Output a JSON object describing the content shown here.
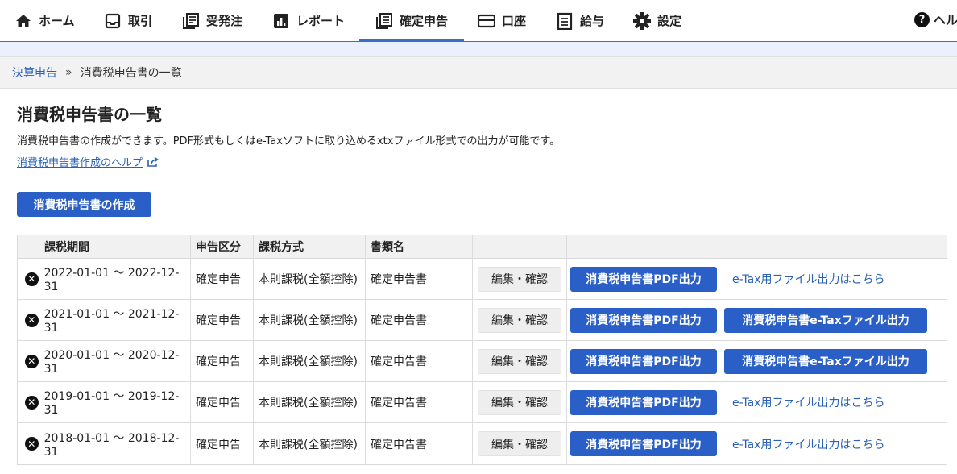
{
  "nav": {
    "items": [
      {
        "label": "ホーム",
        "icon": "home-icon"
      },
      {
        "label": "取引",
        "icon": "inbox-icon"
      },
      {
        "label": "受発注",
        "icon": "documents-icon"
      },
      {
        "label": "レポート",
        "icon": "chart-icon"
      },
      {
        "label": "確定申告",
        "icon": "tax-return-icon"
      },
      {
        "label": "口座",
        "icon": "card-icon"
      },
      {
        "label": "給与",
        "icon": "payroll-icon"
      },
      {
        "label": "設定",
        "icon": "gear-icon"
      }
    ],
    "help_label": "ヘルプ",
    "active_index": 4,
    "accent_color": "#3a6fc4"
  },
  "breadcrumb": {
    "parent": "決算申告",
    "separator": "»",
    "current": "消費税申告書の一覧"
  },
  "page": {
    "title": "消費税申告書の一覧",
    "description": "消費税申告書の作成ができます。PDF形式もしくはe-Taxソフトに取り込めるxtxファイル形式での出力が可能です。",
    "help_link": "消費税申告書作成のヘルプ",
    "create_button": "消費税申告書の作成",
    "button_color": "#2a5fc7"
  },
  "table": {
    "headers": [
      "課税期間",
      "申告区分",
      "課税方式",
      "書類名",
      "",
      ""
    ],
    "rows": [
      {
        "period": "2022-01-01 ～ 2022-12-31",
        "kubun": "確定申告",
        "method": "本則課税(全額控除)",
        "doc": "確定申告書",
        "edit": "編集・確認",
        "pdf": "消費税申告書PDF出力",
        "etax_type": "link",
        "etax": "e-Tax用ファイル出力はこちら"
      },
      {
        "period": "2021-01-01 ～ 2021-12-31",
        "kubun": "確定申告",
        "method": "本則課税(全額控除)",
        "doc": "確定申告書",
        "edit": "編集・確認",
        "pdf": "消費税申告書PDF出力",
        "etax_type": "button",
        "etax": "消費税申告書e-Taxファイル出力"
      },
      {
        "period": "2020-01-01 ～ 2020-12-31",
        "kubun": "確定申告",
        "method": "本則課税(全額控除)",
        "doc": "確定申告書",
        "edit": "編集・確認",
        "pdf": "消費税申告書PDF出力",
        "etax_type": "button",
        "etax": "消費税申告書e-Taxファイル出力"
      },
      {
        "period": "2019-01-01 ～ 2019-12-31",
        "kubun": "確定申告",
        "method": "本則課税(全額控除)",
        "doc": "確定申告書",
        "edit": "編集・確認",
        "pdf": "消費税申告書PDF出力",
        "etax_type": "link",
        "etax": "e-Tax用ファイル出力はこちら"
      },
      {
        "period": "2018-01-01 ～ 2018-12-31",
        "kubun": "確定申告",
        "method": "本則課税(全額控除)",
        "doc": "確定申告書",
        "edit": "編集・確認",
        "pdf": "消費税申告書PDF出力",
        "etax_type": "link",
        "etax": "e-Tax用ファイル出力はこちら"
      }
    ]
  }
}
